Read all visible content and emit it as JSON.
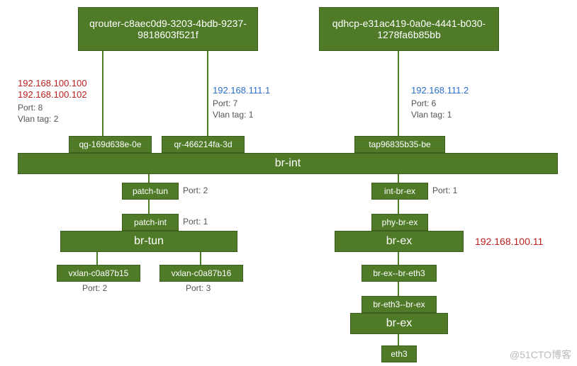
{
  "qrouter": "qrouter-c8aec0d9-3203-4bdb-9237-9818603f521f",
  "qdhcp": "qdhcp-e31ac419-0a0e-4441-b030-1278fa6b85bb",
  "left": {
    "ip1": "192.168.100.100",
    "ip2": "192.168.100.102",
    "port": "Port: 8",
    "vlan": "Vlan tag: 2",
    "name": "qg-169d638e-0e"
  },
  "mid": {
    "ip": "192.168.111.1",
    "port": "Port: 7",
    "vlan": "Vlan tag: 1",
    "name": "qr-466214fa-3d"
  },
  "right": {
    "ip": "192.168.111.2",
    "port": "Port: 6",
    "vlan": "Vlan tag: 1",
    "name": "tap96835b35-be"
  },
  "brint": "br-int",
  "patch_tun": "patch-tun",
  "patch_tun_port": "Port: 2",
  "int_br_ex": "int-br-ex",
  "int_br_ex_port": "Port: 1",
  "patch_int": "patch-int",
  "patch_int_port": "Port: 1",
  "brtun": "br-tun",
  "vxlan1": "vxlan-c0a87b15",
  "vxlan1_port": "Port: 2",
  "vxlan2": "vxlan-c0a87b16",
  "vxlan2_port": "Port: 3",
  "phy_br_ex": "phy-br-ex",
  "brex": "br-ex",
  "brex_ip": "192.168.100.11",
  "brex_breth3": "br-ex--br-eth3",
  "breth3_brex": "br-eth3--br-ex",
  "brex2": "br-ex",
  "eth3": "eth3",
  "watermark": "@51CTO博客"
}
